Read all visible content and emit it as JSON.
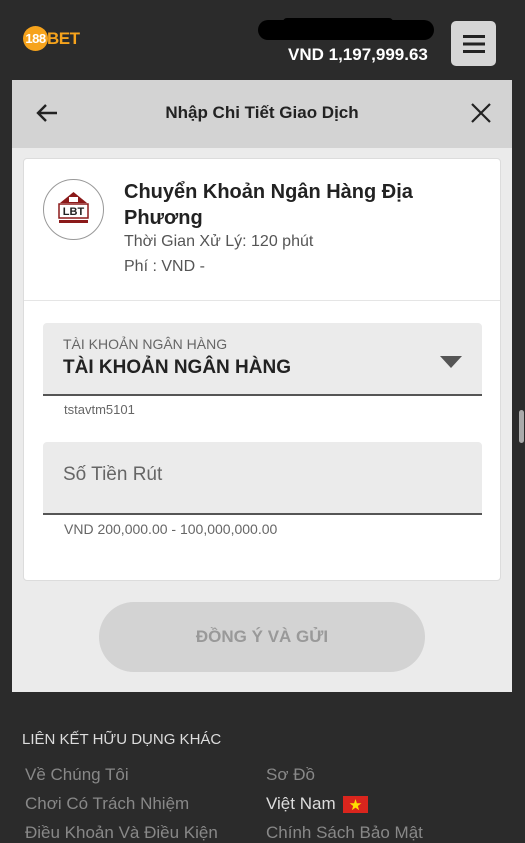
{
  "header": {
    "logo_number": "188",
    "logo_text": "BET",
    "balance": "VND 1,197,999.63"
  },
  "panel": {
    "title": "Nhập Chi Tiết Giao Dịch",
    "bank": {
      "logo_text": "LBT",
      "name": "Chuyển Khoản Ngân Hàng Địa Phương",
      "processing_time": "Thời Gian Xử Lý: 120 phút",
      "fee": "Phí : VND -"
    },
    "account_select": {
      "label": "TÀI KHOẢN NGÂN HÀNG",
      "value": "TÀI KHOẢN NGÂN HÀNG",
      "hint": "tstavtm5101"
    },
    "amount": {
      "placeholder": "Số Tiền Rút",
      "value": "",
      "range_hint": "VND 200,000.00 - 100,000,000.00"
    },
    "submit_label": "ĐỒNG Ý VÀ GỬI"
  },
  "footer": {
    "heading": "LIÊN KẾT HỮU DỤNG KHÁC",
    "links_left": [
      "Về Chúng Tôi",
      "Chơi Có Trách Nhiệm",
      "Điều Khoản Và Điều Kiện"
    ],
    "links_right": [
      "Sơ Đồ",
      "Chính Sách Bảo Mật"
    ],
    "language": "Việt Nam"
  },
  "colors": {
    "brand": "#f6a31c",
    "background": "#2b2b2b",
    "panel": "#ebebeb",
    "flag_red": "#da251d",
    "flag_star": "#ffde00"
  }
}
